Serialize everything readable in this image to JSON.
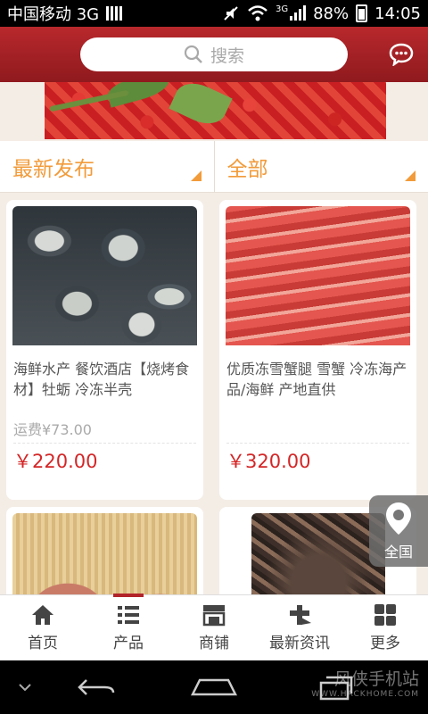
{
  "status_bar": {
    "carrier": "中国移动 3G",
    "network": "3G",
    "battery": "88%",
    "time": "14:05"
  },
  "search": {
    "placeholder": "搜索"
  },
  "filters": [
    {
      "label": "最新发布"
    },
    {
      "label": "全部"
    }
  ],
  "products": [
    {
      "title": "海鲜水产 餐饮酒店【烧烤食材】牡蛎 冷冻半壳",
      "shipping": "运费¥73.00",
      "price": "￥220.00",
      "image": "oysters"
    },
    {
      "title": "优质冻雪蟹腿 雪蟹 冷冻海产品/海鲜 产地直供",
      "shipping": "",
      "price": "￥320.00",
      "image": "crab-legs"
    },
    {
      "title": "",
      "shipping": "",
      "price": "",
      "image": "tongue"
    },
    {
      "title": "",
      "shipping": "",
      "price": "",
      "image": "dried-seafood"
    }
  ],
  "region_button": {
    "label": "全国"
  },
  "tabs": [
    {
      "label": "首页",
      "icon": "home-icon"
    },
    {
      "label": "产品",
      "icon": "list-icon"
    },
    {
      "label": "商铺",
      "icon": "store-icon"
    },
    {
      "label": "最新资讯",
      "icon": "news-icon"
    },
    {
      "label": "更多",
      "icon": "grid-icon"
    }
  ],
  "watermark": {
    "name": "风侠手机站",
    "url": "WWW.HACKHOME.COM"
  },
  "colors": {
    "header": "#a52227",
    "accent": "#f29b3a",
    "price": "#d42627"
  }
}
